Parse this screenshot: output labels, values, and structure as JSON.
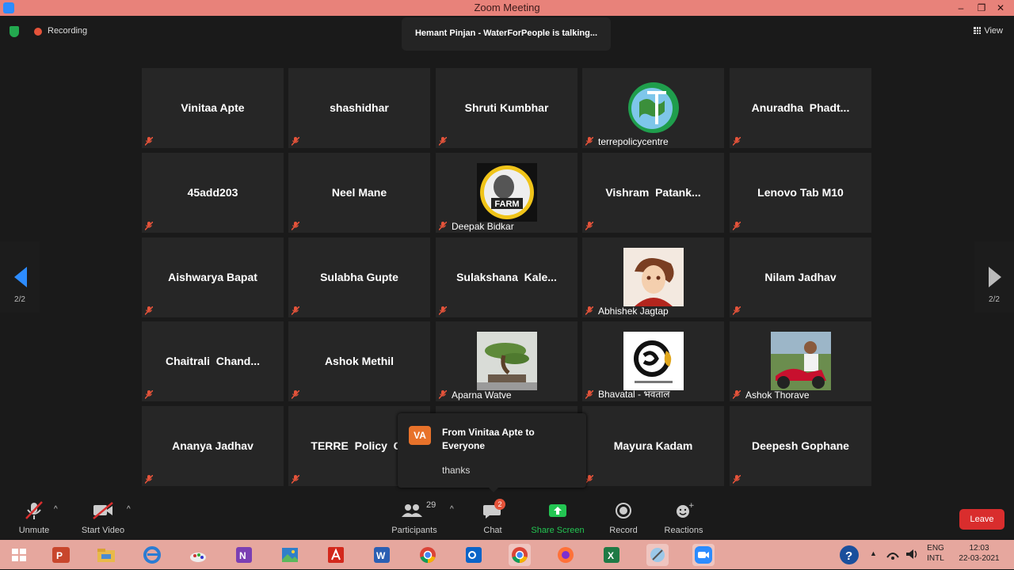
{
  "window": {
    "title": "Zoom Meeting",
    "controls": [
      "–",
      "❐",
      "✕"
    ]
  },
  "topbar": {
    "recording_label": "Recording",
    "talking_text": "Hemant Pinjan - WaterForPeople is talking...",
    "view_label": "View"
  },
  "pager": {
    "left_label": "2/2",
    "right_label": "2/2"
  },
  "participants": [
    {
      "name": "Vinitaa Apte",
      "label": "",
      "avatar": null
    },
    {
      "name": "shashidhar",
      "label": "",
      "avatar": null
    },
    {
      "name": "Shruti Kumbhar",
      "label": "",
      "avatar": null
    },
    {
      "name": "",
      "label": "terrepolicycentre",
      "avatar": "globe-logo"
    },
    {
      "name": "Anuradha  Phadt...",
      "label": "",
      "avatar": null
    },
    {
      "name": "45add203",
      "label": "",
      "avatar": null
    },
    {
      "name": "Neel Mane",
      "label": "",
      "avatar": null
    },
    {
      "name": "",
      "label": "Deepak Bidkar",
      "avatar": "farm-badge"
    },
    {
      "name": "Vishram  Patank...",
      "label": "",
      "avatar": null
    },
    {
      "name": "Lenovo Tab M10",
      "label": "",
      "avatar": null
    },
    {
      "name": "Aishwarya Bapat",
      "label": "",
      "avatar": null
    },
    {
      "name": "Sulabha Gupte",
      "label": "",
      "avatar": null
    },
    {
      "name": "Sulakshana  Kale...",
      "label": "",
      "avatar": null
    },
    {
      "name": "",
      "label": "Abhishek Jagtap",
      "avatar": "anime-portrait"
    },
    {
      "name": "Nilam Jadhav",
      "label": "",
      "avatar": null
    },
    {
      "name": "Chaitrali  Chand...",
      "label": "",
      "avatar": null
    },
    {
      "name": "Ashok Methil",
      "label": "",
      "avatar": null
    },
    {
      "name": "",
      "label": "Aparna Watve",
      "avatar": "bonsai-photo"
    },
    {
      "name": "",
      "label": "Bhavatal - भवताल",
      "avatar": "bhavatal-logo"
    },
    {
      "name": "",
      "label": "Ashok Thorave",
      "avatar": "bike-photo"
    },
    {
      "name": "Ananya Jadhav",
      "label": "",
      "avatar": null
    },
    {
      "name": "TERRE  Policy  Ce",
      "label": "",
      "avatar": null
    },
    {
      "name": "",
      "label": "",
      "avatar": null
    },
    {
      "name": "Mayura Kadam",
      "label": "",
      "avatar": null
    },
    {
      "name": "Deepesh Gophane",
      "label": "",
      "avatar": null
    }
  ],
  "chat_popup": {
    "initials": "VA",
    "from": "From Vinitaa Apte to Everyone",
    "message": "thanks"
  },
  "toolbar": {
    "unmute": "Unmute",
    "start_video": "Start Video",
    "participants": "Participants",
    "participants_count": "29",
    "chat": "Chat",
    "chat_badge": "2",
    "share_screen": "Share Screen",
    "record": "Record",
    "reactions": "Reactions",
    "leave": "Leave"
  },
  "taskbar": {
    "apps": [
      "windows-start",
      "powerpoint",
      "file-explorer",
      "internet-explorer",
      "paint-app",
      "onenote",
      "photos",
      "acrobat",
      "word",
      "chrome",
      "outlook",
      "chrome-profile",
      "firefox",
      "excel",
      "snipping-tool",
      "zoom"
    ],
    "lang_line1": "ENG",
    "lang_line2": "INTL",
    "time": "12:03",
    "date": "22-03-2021"
  },
  "colors": {
    "accent": "#2d8cff",
    "leave": "#d92d2d",
    "share": "#23c552",
    "titlebar": "#e8827a",
    "taskbar": "#e6a79e"
  }
}
